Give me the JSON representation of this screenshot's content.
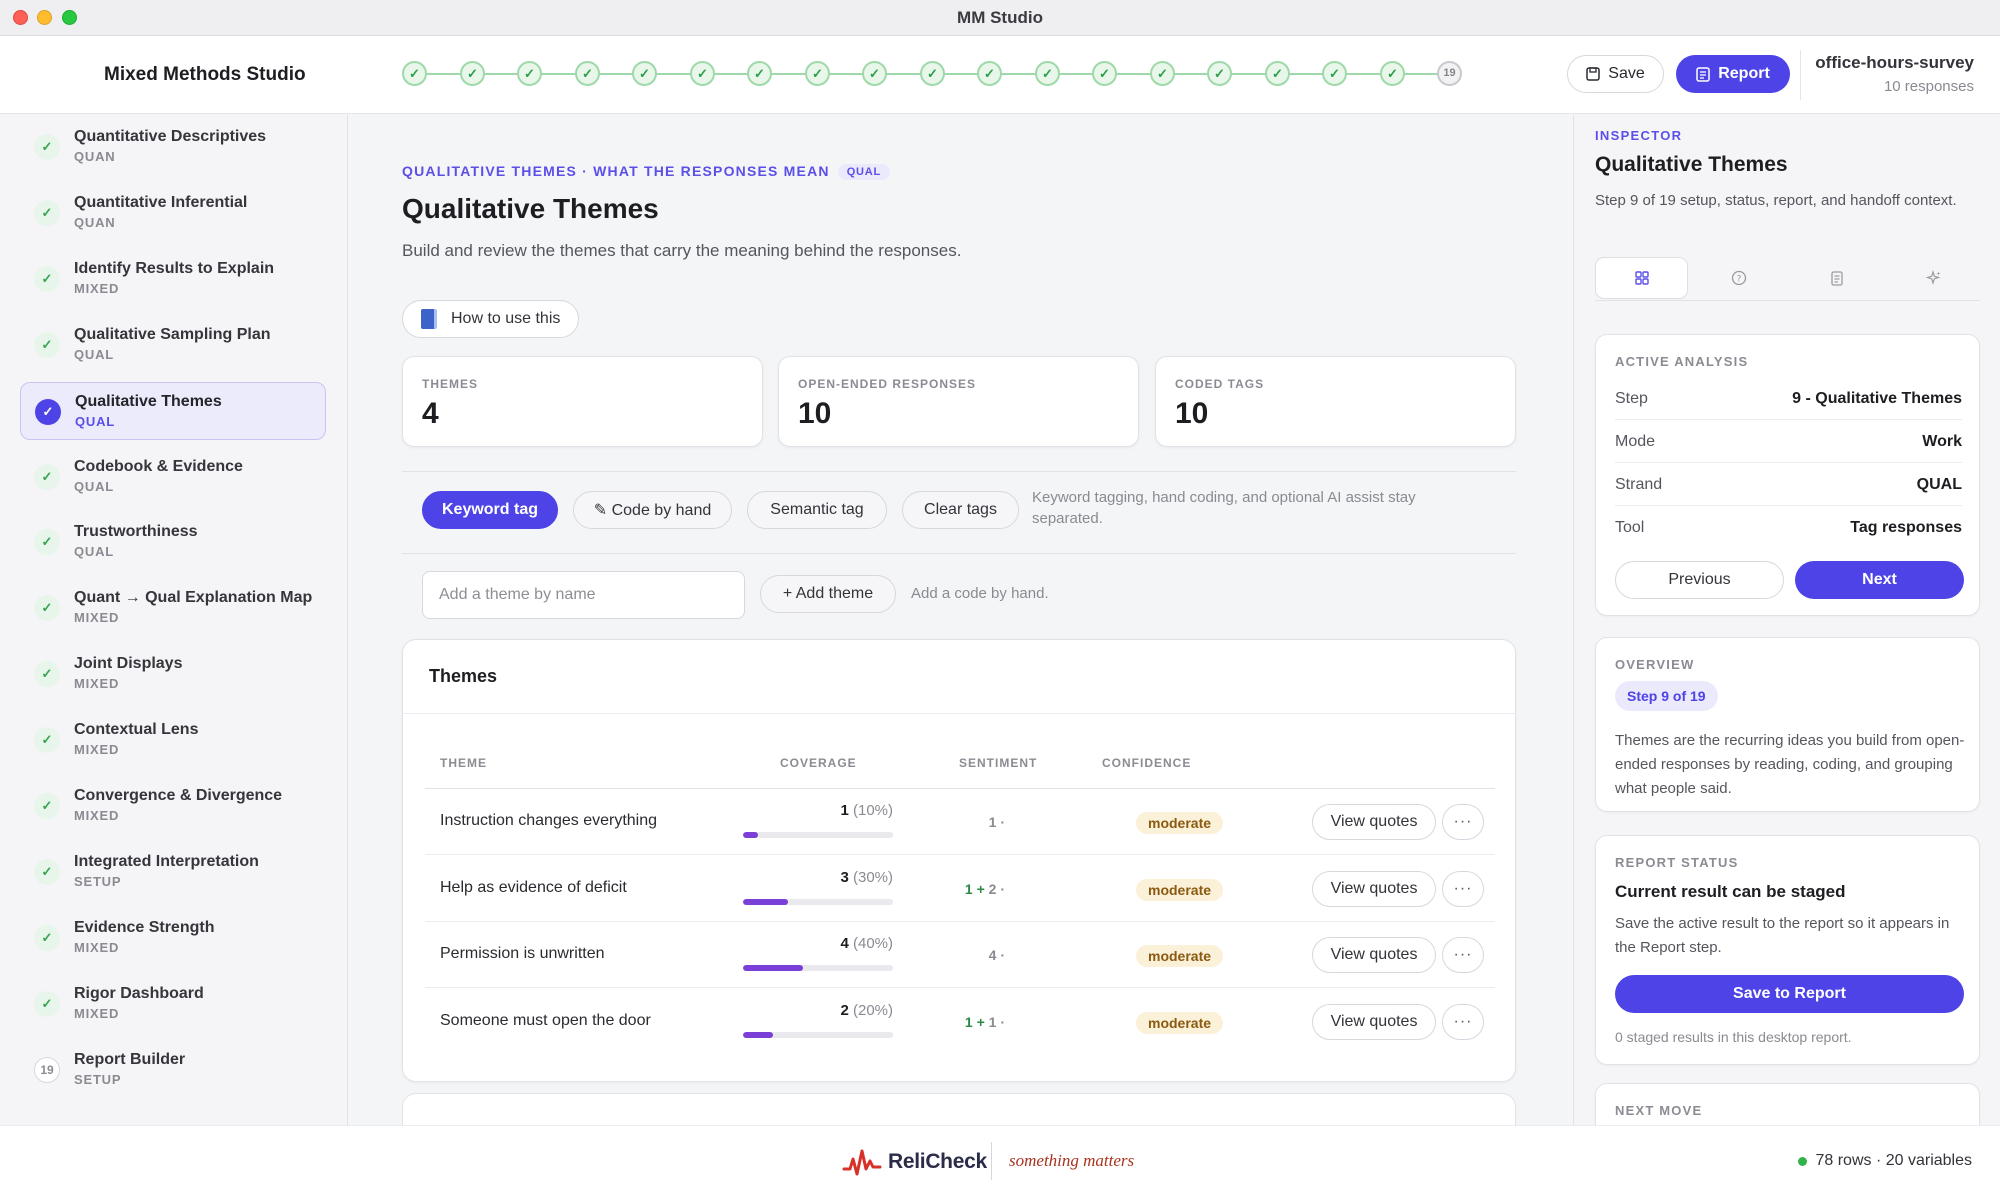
{
  "window": {
    "title": "MM Studio"
  },
  "header": {
    "brand": "Mixed Methods Studio",
    "stepper": {
      "total": 19,
      "completed": 18,
      "current_label": "19",
      "done_glyph": "✓"
    },
    "save_label": "Save",
    "report_label": "Report",
    "project_name": "office-hours-survey",
    "project_sub": "10 responses"
  },
  "sidebar": {
    "items": [
      {
        "label": "Quantitative Descriptives",
        "tag": "QUAN",
        "icon": "✓"
      },
      {
        "label": "Quantitative Inferential",
        "tag": "QUAN",
        "icon": "✓"
      },
      {
        "label": "Identify Results to Explain",
        "tag": "MIXED",
        "icon": "✓"
      },
      {
        "label": "Qualitative Sampling Plan",
        "tag": "QUAL",
        "icon": "✓"
      },
      {
        "label": "Qualitative Themes",
        "tag": "QUAL",
        "icon": "✓"
      },
      {
        "label": "Codebook & Evidence",
        "tag": "QUAL",
        "icon": "✓"
      },
      {
        "label": "Trustworthiness",
        "tag": "QUAL",
        "icon": "✓"
      },
      {
        "label": "Quant → Qual Explanation Map",
        "tag": "MIXED",
        "icon": "✓"
      },
      {
        "label": "Joint Displays",
        "tag": "MIXED",
        "icon": "✓"
      },
      {
        "label": "Contextual Lens",
        "tag": "MIXED",
        "icon": "✓"
      },
      {
        "label": "Convergence & Divergence",
        "tag": "MIXED",
        "icon": "✓"
      },
      {
        "label": "Integrated Interpretation",
        "tag": "SETUP",
        "icon": "✓"
      },
      {
        "label": "Evidence Strength",
        "tag": "MIXED",
        "icon": "✓"
      },
      {
        "label": "Rigor Dashboard",
        "tag": "MIXED",
        "icon": "✓"
      },
      {
        "label": "Report Builder",
        "tag": "SETUP",
        "icon": "19"
      }
    ]
  },
  "main": {
    "eyebrow": "QUALITATIVE THEMES · WHAT THE RESPONSES MEAN",
    "eyebrow_pill": "QUAL",
    "title": "Qualitative Themes",
    "description": "Build and review the themes that carry the meaning behind the responses.",
    "how_to": "How to use this",
    "stats": [
      {
        "label": "THEMES",
        "value": "4"
      },
      {
        "label": "OPEN-ENDED RESPONSES",
        "value": "10"
      },
      {
        "label": "CODED TAGS",
        "value": "10"
      }
    ],
    "toolbar": {
      "keyword_tag": "Keyword tag",
      "code_by_hand": "✎ Code by hand",
      "semantic_tag": "Semantic tag",
      "clear_tags": "Clear tags",
      "note": "Keyword tagging, hand coding, and optional AI assist stay separated."
    },
    "add_theme": {
      "placeholder": "Add a theme by name",
      "button": "+ Add theme",
      "hint": "Add a code by hand."
    },
    "themes": {
      "title": "Themes",
      "columns": [
        "THEME",
        "COVERAGE",
        "SENTIMENT",
        "CONFIDENCE"
      ],
      "view_label": "View quotes",
      "more_label": "···",
      "rows": [
        {
          "theme": "Instruction changes everything",
          "count": "1",
          "pct": "(10%)",
          "fraction": 0.1,
          "sent_pos": "",
          "sent_plus": "",
          "sent_neutral": "1",
          "sent_dot": "·",
          "confidence": "moderate"
        },
        {
          "theme": "Help as evidence of deficit",
          "count": "3",
          "pct": "(30%)",
          "fraction": 0.3,
          "sent_pos": "1",
          "sent_plus": "+",
          "sent_neutral": "2",
          "sent_dot": "·",
          "confidence": "moderate"
        },
        {
          "theme": "Permission is unwritten",
          "count": "4",
          "pct": "(40%)",
          "fraction": 0.4,
          "sent_pos": "",
          "sent_plus": "",
          "sent_neutral": "4",
          "sent_dot": "·",
          "confidence": "moderate"
        },
        {
          "theme": "Someone must open the door",
          "count": "2",
          "pct": "(20%)",
          "fraction": 0.2,
          "sent_pos": "1",
          "sent_plus": "+",
          "sent_neutral": "1",
          "sent_dot": "·",
          "confidence": "moderate"
        }
      ]
    }
  },
  "inspector": {
    "eyebrow": "INSPECTOR",
    "title": "Qualitative Themes",
    "description": "Step 9 of 19 setup, status, report, and handoff context.",
    "active": {
      "label": "ACTIVE ANALYSIS",
      "rows": [
        {
          "k": "Step",
          "v": "9 - Qualitative Themes"
        },
        {
          "k": "Mode",
          "v": "Work"
        },
        {
          "k": "Strand",
          "v": "QUAL"
        },
        {
          "k": "Tool",
          "v": "Tag responses"
        }
      ],
      "previous": "Previous",
      "next": "Next"
    },
    "overview": {
      "label": "OVERVIEW",
      "badge": "Step 9 of 19",
      "text": "Themes are the recurring ideas you build from open-ended responses by reading, coding, and grouping what people said."
    },
    "report_status": {
      "label": "REPORT STATUS",
      "title": "Current result can be staged",
      "description": "Save the active result to the report so it appears in the Report step.",
      "button": "Save to Report",
      "footnote": "0 staged results in this desktop report."
    },
    "next_move": {
      "label": "NEXT MOVE"
    }
  },
  "footer": {
    "logo_text": "ReliCheck",
    "tagline": "something matters",
    "status": "78 rows · 20 variables"
  },
  "colors": {
    "accent": "#4d43e6",
    "success": "#2fb34a",
    "coverage_bar": "#7a3fd6",
    "confidence_badge": "#fbf0d8"
  }
}
